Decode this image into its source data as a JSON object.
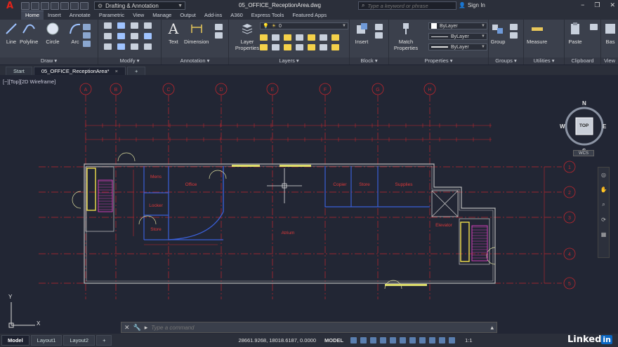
{
  "app": {
    "logo_letter": "A",
    "document_title": "05_OFFICE_ReceptionArea.dwg"
  },
  "workspace": {
    "label": "Drafting & Annotation"
  },
  "search": {
    "placeholder": "Type a keyword or phrase"
  },
  "signin": {
    "label": "Sign In"
  },
  "window_controls": [
    "−",
    "❐",
    "✕"
  ],
  "ribbon_tabs": [
    "Home",
    "Insert",
    "Annotate",
    "Parametric",
    "View",
    "Manage",
    "Output",
    "Add-ins",
    "A360",
    "Express Tools",
    "Featured Apps"
  ],
  "ribbon_active_tab": "Home",
  "panels": {
    "draw": {
      "title": "Draw",
      "buttons": [
        "Line",
        "Polyline",
        "Circle",
        "Arc"
      ]
    },
    "modify": {
      "title": "Modify"
    },
    "annotation": {
      "title": "Annotation",
      "buttons": [
        "Text",
        "Dimension"
      ]
    },
    "layers": {
      "title": "Layers",
      "button": "Layer Properties",
      "layer_value": "0"
    },
    "block": {
      "title": "Block",
      "button": "Insert"
    },
    "properties": {
      "title": "Properties",
      "button": "Match Properties",
      "color": "ByLayer",
      "linetype": "ByLayer",
      "lineweight": "ByLayer"
    },
    "groups": {
      "title": "Groups",
      "button": "Group"
    },
    "utilities": {
      "title": "Utilities",
      "button": "Measure"
    },
    "clipboard": {
      "title": "Clipboard",
      "button": "Paste"
    },
    "view": {
      "title": "View",
      "button": "Bas"
    }
  },
  "file_tabs": [
    "Start",
    "05_OFFICE_ReceptionArea*"
  ],
  "file_tab_add": "+",
  "viewport_label": "[−][Top][2D Wireframe]",
  "viewcube": {
    "top": "TOP",
    "n": "N",
    "s": "S",
    "e": "E",
    "w": "W",
    "wcs": "WCS"
  },
  "drawing": {
    "grid_columns": [
      "A",
      "B",
      "C",
      "D",
      "E",
      "F",
      "G",
      "H"
    ],
    "grid_rows": [
      "1",
      "2",
      "3",
      "4",
      "5"
    ],
    "rooms": [
      "Mens",
      "Office",
      "Locker",
      "Store",
      "Atrium",
      "Copier",
      "Store",
      "Supplies",
      "Elevator"
    ]
  },
  "ucs": {
    "x": "X",
    "y": "Y"
  },
  "command": {
    "placeholder": "Type a command"
  },
  "status": {
    "layout_tabs": [
      "Model",
      "Layout1",
      "Layout2"
    ],
    "layout_add": "+",
    "coords": "28661.9268, 18018.6187, 0.0000",
    "model": "MODEL",
    "scale": "1:1"
  },
  "brand": {
    "linked": "Linked",
    "in": "in"
  },
  "colors": {
    "background": "#222634",
    "gridline": "#c0262e",
    "walls": "#b9b9b9",
    "blue_walls": "#3a5fd6",
    "doors": "#e0e0a0",
    "stair": "#cf3fb8"
  }
}
